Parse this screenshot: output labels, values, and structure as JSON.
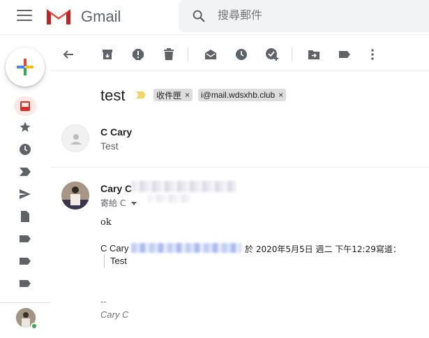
{
  "header": {
    "brand": "Gmail",
    "search_placeholder": "搜尋郵件"
  },
  "sidebar": {
    "items": [
      {
        "icon": "inbox-icon"
      },
      {
        "icon": "star-icon"
      },
      {
        "icon": "clock-icon"
      },
      {
        "icon": "important-icon"
      },
      {
        "icon": "send-icon"
      },
      {
        "icon": "draft-icon"
      },
      {
        "icon": "label-icon"
      },
      {
        "icon": "label-icon"
      },
      {
        "icon": "label-icon"
      }
    ]
  },
  "toolbar": {
    "buttons": [
      "back-icon",
      "archive-icon",
      "report-spam-icon",
      "delete-icon",
      "mark-unread-icon",
      "snooze-icon",
      "add-task-icon",
      "move-to-icon",
      "label-icon",
      "more-icon"
    ]
  },
  "thread": {
    "subject": "test",
    "labels": [
      {
        "text": "收件匣",
        "close": "×"
      },
      {
        "text": "i@mail.wdsxhb.club",
        "close": "×"
      }
    ]
  },
  "messages": [
    {
      "sender": "C Cary",
      "snippet": "Test"
    },
    {
      "sender": "Cary C",
      "to_prefix": "寄給 C",
      "body_line1": "ok",
      "quote_prefix": "C Cary",
      "quote_suffix": "於 2020年5月5日 週二 下午12:29寫道：",
      "quoted_text": "Test",
      "sig_dashes": "--",
      "sig_name": "Cary C"
    }
  ],
  "colors": {
    "accent_red": "#ea4335",
    "icon_gray": "#5f6368",
    "important_yellow": "#f4d35e",
    "chip_bg": "#dddddd"
  }
}
